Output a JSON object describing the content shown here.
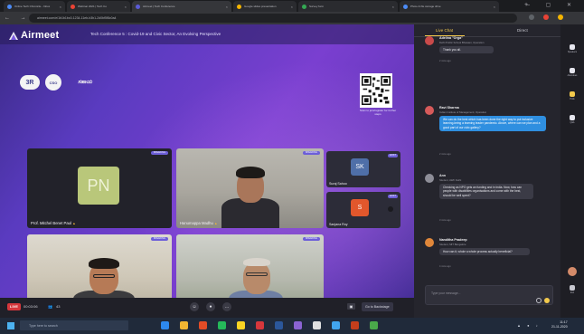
{
  "browser": {
    "tabs": [
      {
        "title": "Online Tech Chronicle - Inbox",
        "favicon_color": "#4c8bf5",
        "active": false
      },
      {
        "title": "Webinar 2021 | Tech Co",
        "favicon_color": "#ea4335",
        "active": false
      },
      {
        "title": "Airmeet | Tech Conference",
        "favicon_color": "#5b5bd6",
        "active": true
      },
      {
        "title": "Google slides presentation",
        "favicon_color": "#f4b400",
        "active": false
      },
      {
        "title": "Survey form",
        "favicon_color": "#34a853",
        "active": false
      },
      {
        "title": "Photo & file storage drive",
        "favicon_color": "#4c8bf5",
        "active": false
      }
    ],
    "new_tab_icon": "plus-icon",
    "window_controls": "─ ▢ ✕",
    "nav_buttons": "← → ⟳",
    "url": "airmeet.com/e/1b1b1bc0-1234-11eb-b3b1-2d0bf5f8c0a4",
    "extension_colors": [
      "#5f6368",
      "#e94235",
      "#f4b400"
    ]
  },
  "stage": {
    "app_name": "Airmeet",
    "event_title": "Tech Conference 5 : Covid-19 and Civic Sector, An Evolving Perspective",
    "brand_logos": {
      "logo_3r": "3R",
      "emblem": "CSO",
      "signature": "ಸಹಾಯ"
    },
    "qr_caption": "Scan to join/register for further steps",
    "speaking_tag": "SPEAKING",
    "host_tag": "HOST",
    "tiles": [
      {
        "name": "Prof. Mitchel Benet Paul",
        "avatar": "PN",
        "avatar_color": "#b9c77a",
        "mic": "▴"
      },
      {
        "name": "Hanumappa Madhu",
        "mic": "▴"
      },
      {
        "name": "Dr. Sandeep Lahiri",
        "mic": "▴"
      },
      {
        "name": "Dr. Chinmay Banerjee",
        "mic": "▴"
      }
    ],
    "mini_tiles": [
      {
        "name": "Suraj Sahoo",
        "avatar": "SK",
        "avatar_color": "#4f6fa8",
        "tag": "HOST"
      },
      {
        "name": "Sanjana Roy",
        "avatar": "S",
        "avatar_color": "#e2572c",
        "tag": "HOST"
      }
    ]
  },
  "controls": {
    "live": "LIVE",
    "timer": "00:03:06",
    "viewers": "43",
    "emoji_icon": "☺",
    "mic_icon": "●",
    "more_icon": "…",
    "screen_icon": "▣",
    "backstage": "Go to Backstage"
  },
  "chat": {
    "tab_live": "Live Chat",
    "tab_direct": "Direct",
    "messages": [
      {
        "author": "Adelina \"Orga\"",
        "org": "Delhi Public School Bhawani, Operation",
        "text": "Thank you all.",
        "time": "2 mins ago",
        "avatar_color": "#c94a4a",
        "style": "gray"
      },
      {
        "author": "Ravi Sharma",
        "org": "Indian Institute of Management, Operation",
        "text": "We can do the best which has been done the right way to put inclusive learning-being a learning leader pandemic. Above, where can we plan and a good part of our civic gallery?",
        "time": "2 mins ago",
        "avatar_color": "#d65a5a",
        "style": "blue"
      },
      {
        "author": "Ann",
        "org": "Student, AWF Delhi",
        "text": "Checking as NPO gets an funding and in India. Now, how can people with disabilities organisations and come with the best, should be well spent?",
        "time": "3 mins ago",
        "avatar_color": "#8e8e98",
        "style": "gray"
      },
      {
        "author": "Nanditha Pradeep",
        "org": "Student, MIT Bangalore",
        "text": "How can it, whole a whole process actually beneficial?",
        "time": "4 mins ago",
        "avatar_color": "#e0873a",
        "style": "gray"
      }
    ],
    "input_placeholder": "Type your message..."
  },
  "rail": {
    "items": [
      {
        "label": "Speakers",
        "icon": "people-icon"
      },
      {
        "label": "Attendees",
        "icon": "group-icon"
      },
      {
        "label": "Polls",
        "icon": "poll-icon"
      },
      {
        "label": "Q&A",
        "icon": "question-icon"
      }
    ],
    "exit_label": "Exit"
  },
  "taskbar": {
    "search_placeholder": "Type here to search",
    "apps": [
      "#2d89ef",
      "#f2b632",
      "#e34c26",
      "#25b95a",
      "#f9d423",
      "#d6373c",
      "#2b579a",
      "#8a63d2",
      "#e0e0e0",
      "#41a5ee",
      "#c43e1c",
      "#4aa84a"
    ],
    "tray": "▲ ● ♪",
    "time": "11:17",
    "date": "21-11-2020"
  }
}
